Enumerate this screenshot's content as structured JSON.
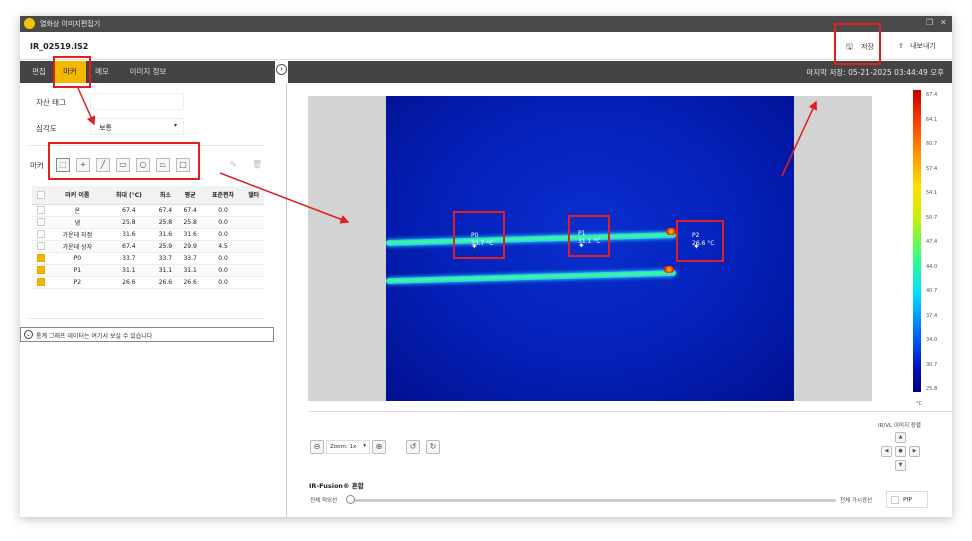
{
  "window": {
    "title": "열화상 이미지편집기"
  },
  "file": {
    "name": "IR_02519.IS2",
    "save_label": "저장",
    "export_label": "내보내기"
  },
  "tabs": [
    {
      "label": "편집",
      "active": false
    },
    {
      "label": "마커",
      "active": true
    },
    {
      "label": "메모",
      "active": false
    },
    {
      "label": "이미지 정보",
      "active": false
    }
  ],
  "last_saved": "마지막 저장: 05-21-2025 03:44:49 오후",
  "asset_tag": {
    "label": "자산 태그",
    "value": ""
  },
  "severity": {
    "label": "심각도",
    "value": "보통"
  },
  "markers_label": "마커",
  "marker_table": {
    "columns": [
      "마커 이름",
      "최대 (°C)",
      "최소",
      "평균",
      "표준편차",
      "델타"
    ],
    "rows": [
      {
        "checked": false,
        "name": "온",
        "max": "67.4",
        "min": "67.4",
        "avg": "67.4",
        "std": "0.0",
        "delta": ""
      },
      {
        "checked": false,
        "name": "냉",
        "max": "25.8",
        "min": "25.8",
        "avg": "25.8",
        "std": "0.0",
        "delta": ""
      },
      {
        "checked": false,
        "name": "가운데 지점",
        "max": "31.6",
        "min": "31.6",
        "avg": "31.6",
        "std": "0.0",
        "delta": ""
      },
      {
        "checked": false,
        "name": "가운데 상자",
        "max": "67.4",
        "min": "25.9",
        "avg": "29.9",
        "std": "4.5",
        "delta": ""
      },
      {
        "checked": true,
        "name": "P0",
        "max": "33.7",
        "min": "33.7",
        "avg": "33.7",
        "std": "0.0",
        "delta": ""
      },
      {
        "checked": true,
        "name": "P1",
        "max": "31.1",
        "min": "31.1",
        "avg": "31.1",
        "std": "0.0",
        "delta": ""
      },
      {
        "checked": true,
        "name": "P2",
        "max": "26.6",
        "min": "26.6",
        "avg": "26.6",
        "std": "0.0",
        "delta": ""
      }
    ]
  },
  "stats_hint": "통계 그래프 데이터는 여기서 보실 수 있습니다",
  "image_markers": [
    {
      "name": "P0",
      "temp": "33.7 °C"
    },
    {
      "name": "P1",
      "temp": "31.1 °C"
    },
    {
      "name": "P2",
      "temp": "26.6 °C"
    }
  ],
  "colorbar": {
    "ticks": [
      "67.4",
      "64.1",
      "60.7",
      "57.4",
      "54.1",
      "50.7",
      "47.4",
      "44.0",
      "40.7",
      "37.4",
      "34.0",
      "30.7",
      "25.8"
    ],
    "unit": "°C"
  },
  "zoom": {
    "label": "Zoom: 1x"
  },
  "alignment": {
    "label": "IR/VL 이미지 정렬"
  },
  "fusion": {
    "title": "IR-Fusion® 혼합",
    "left_label": "전체 적외선",
    "right_label": "전체 가시광선",
    "pip_label": "PIP",
    "value_percent": 0
  },
  "colors": {
    "accent": "#f5b800",
    "toolbar": "#444444",
    "annotation": "#e02020"
  },
  "icons": [
    "wifi-logo-icon",
    "restore-icon",
    "close-icon",
    "floppy-icon",
    "upload-icon",
    "chevron-right-icon",
    "pencil-icon",
    "trash-icon",
    "zoom-out-icon",
    "zoom-in-icon",
    "rotate-ccw-icon",
    "rotate-cw-icon",
    "arrow-up-icon",
    "arrow-down-icon",
    "arrow-left-icon",
    "arrow-right-icon",
    "chevron-down-icon"
  ]
}
